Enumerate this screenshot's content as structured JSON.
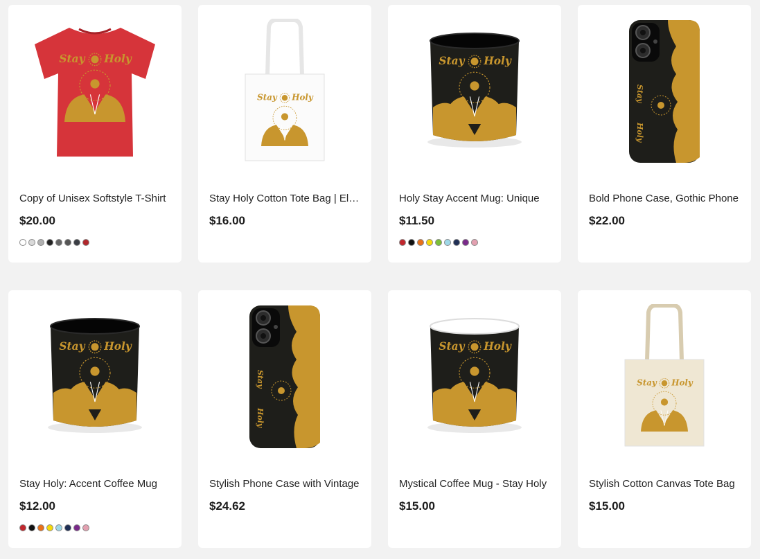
{
  "products": [
    {
      "title": "Copy of Unisex Softstyle T-Shirt",
      "price": "$20.00",
      "product_type": "tshirt",
      "print_text": [
        "Stay",
        "Holy"
      ],
      "swatches": [
        "#ffffff",
        "#d9d9d9",
        "#b0b0b0",
        "#222222",
        "#666666",
        "#555555",
        "#3a3d44",
        "#b0262b"
      ]
    },
    {
      "title": "Stay Holy Cotton Tote Bag | Elegant",
      "price": "$16.00",
      "product_type": "tote-white",
      "print_text": [
        "Stay",
        "Holy"
      ],
      "swatches": []
    },
    {
      "title": "Holy Stay Accent Mug: Unique",
      "price": "$11.50",
      "product_type": "mug-black",
      "print_text": [
        "Stay",
        "Holy"
      ],
      "swatches": [
        "#c1272d",
        "#111111",
        "#e8701a",
        "#f5d90a",
        "#7bbf3a",
        "#9fd8e8",
        "#1f2f55",
        "#7a2a8a",
        "#e3a0b0"
      ]
    },
    {
      "title": "Bold Phone Case, Gothic Phone",
      "price": "$22.00",
      "product_type": "phone",
      "print_text": [
        "Stay",
        "Holy"
      ],
      "swatches": []
    },
    {
      "title": "Stay Holy: Accent Coffee Mug",
      "price": "$12.00",
      "product_type": "mug-black",
      "print_text": [
        "Stay",
        "Holy"
      ],
      "swatches": [
        "#c1272d",
        "#111111",
        "#e8701a",
        "#f5d90a",
        "#9fd8e8",
        "#1f2f55",
        "#7a2a8a",
        "#e3a0b0"
      ]
    },
    {
      "title": "Stylish Phone Case with Vintage",
      "price": "$24.62",
      "product_type": "phone",
      "print_text": [
        "Stay",
        "Holy"
      ],
      "swatches": []
    },
    {
      "title": "Mystical Coffee Mug - Stay Holy",
      "price": "$15.00",
      "product_type": "mug-white-rim",
      "print_text": [
        "Stay",
        "Holy"
      ],
      "swatches": []
    },
    {
      "title": "Stylish Cotton Canvas Tote Bag",
      "price": "$15.00",
      "product_type": "tote-natural",
      "print_text": [
        "Stay",
        "Holy"
      ],
      "swatches": []
    }
  ],
  "colors": {
    "gold": "#c8962e",
    "shirt_red": "#d6343a",
    "mug_black": "#1e1e1a",
    "tote_white": "#fbfbfb",
    "tote_natural": "#efe7d3"
  }
}
